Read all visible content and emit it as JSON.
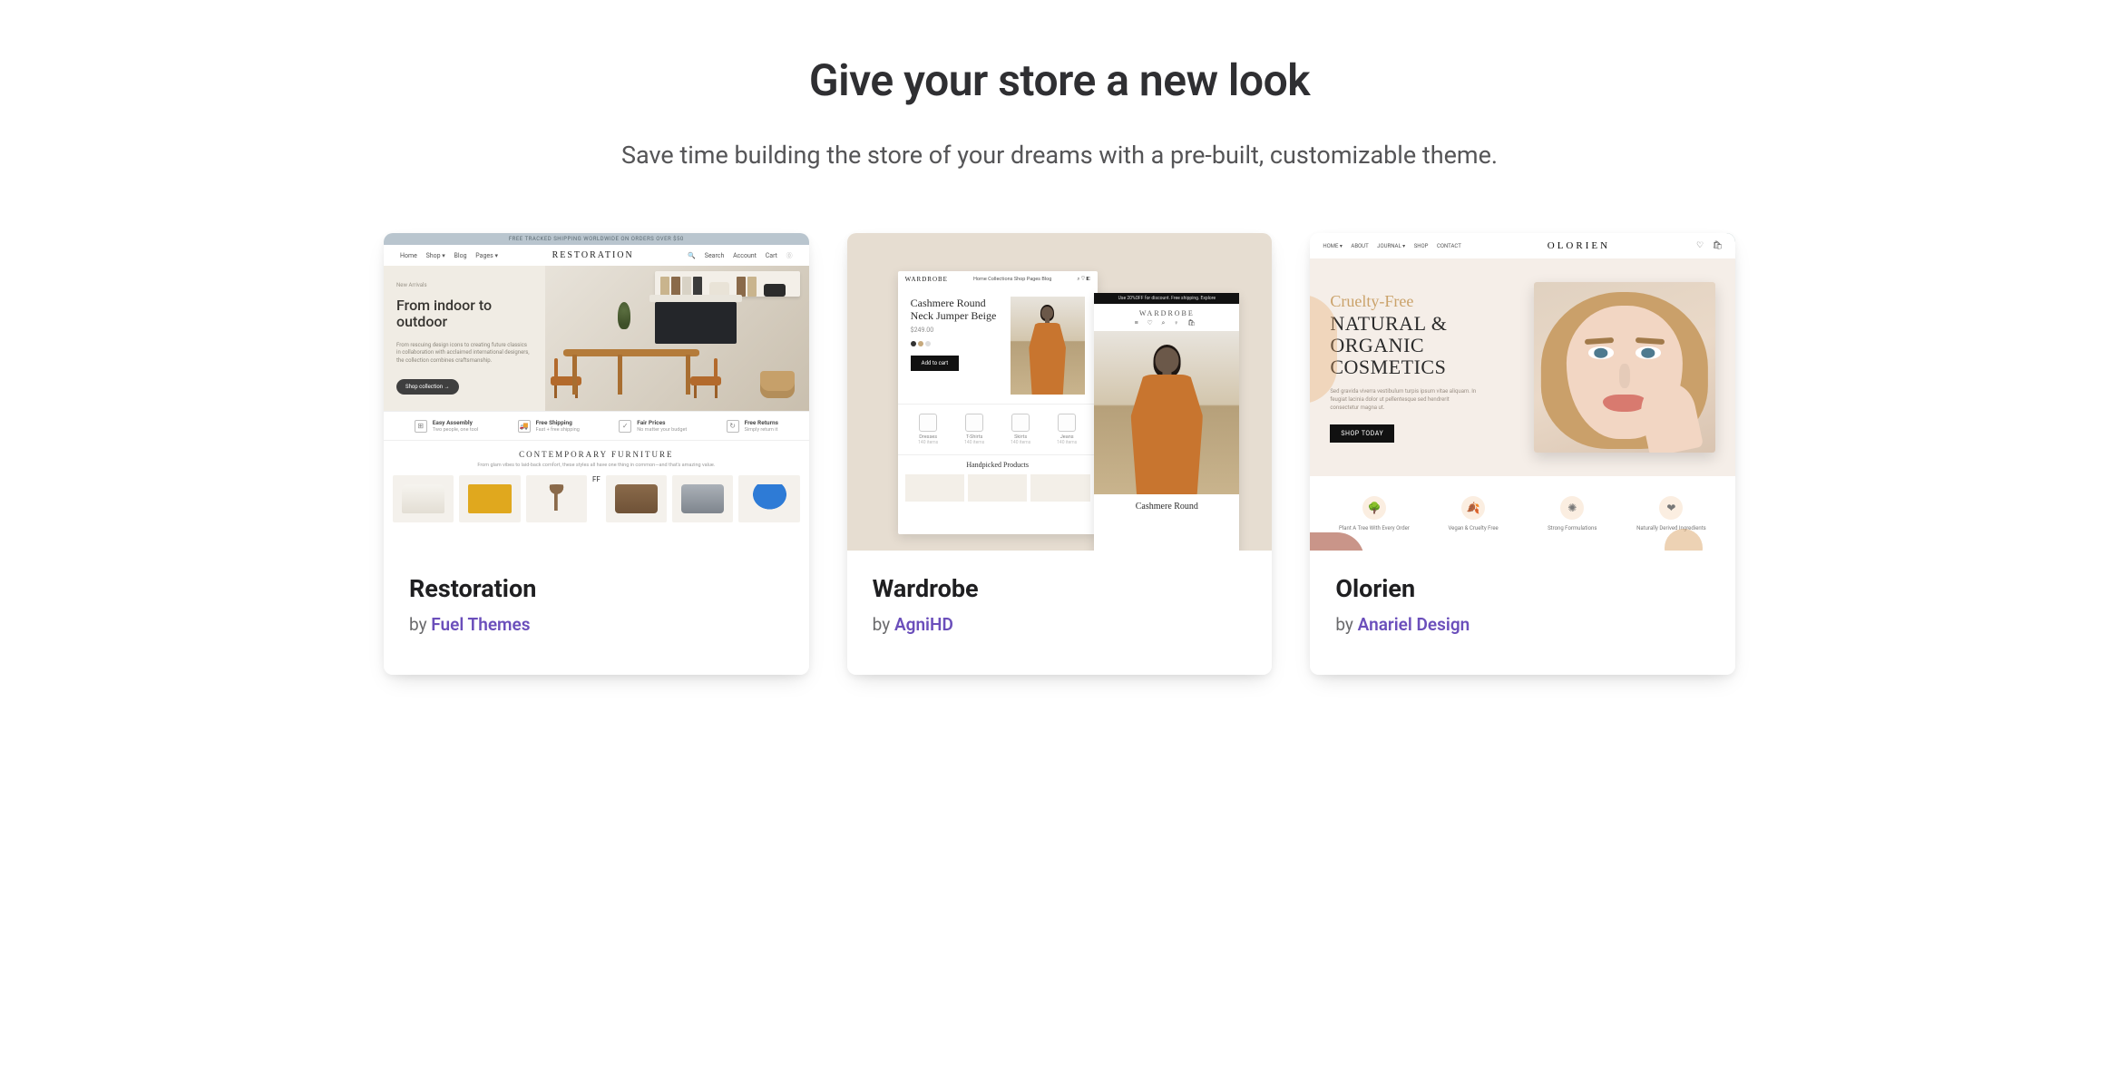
{
  "heading": "Give your store a new look",
  "subheading": "Save time building the store of your dreams with a pre-built, customizable theme.",
  "by_prefix": "by ",
  "themes": [
    {
      "name": "Restoration",
      "author": "Fuel Themes",
      "preview": {
        "topbar": "FREE TRACKED SHIPPING WORLDWIDE ON ORDERS OVER $50",
        "brand": "RESTORATION",
        "nav_left": [
          "Home",
          "Shop ▾",
          "Blog",
          "Pages ▾"
        ],
        "nav_right": [
          "🔍",
          "Search",
          "Account",
          "Cart",
          "⓪"
        ],
        "hero": {
          "eyebrow": "New Arrivals",
          "headline": "From indoor to outdoor",
          "desc": "From rescuing design icons to creating future classics in collaboration with acclaimed international designers, the collection combines craftsmanship.",
          "cta": "Shop collection  →"
        },
        "features": [
          {
            "icon": "⊞",
            "title": "Easy Assembly",
            "sub": "Two people, one tool"
          },
          {
            "icon": "🚚",
            "title": "Free Shipping",
            "sub": "Fast + free shipping"
          },
          {
            "icon": "✓",
            "title": "Fair Prices",
            "sub": "No matter your budget"
          },
          {
            "icon": "↻",
            "title": "Free Returns",
            "sub": "Simply return it"
          }
        ],
        "section_title": "CONTEMPORARY FURNITURE",
        "section_sub": "From glam vibes to laid-back comfort, these styles all have one thing in common—and that's amazing value.",
        "thumbs": [
          "#e9e6df",
          "#e0a81e",
          "#8a6a4a",
          "#8a6a4a",
          "#9aa0a6",
          "#2e7bd6"
        ]
      }
    },
    {
      "name": "Wardrobe",
      "author": "AgniHD",
      "preview": {
        "brand": "WARDROBE",
        "nav_left": [
          "Home",
          "Collections",
          "Shop",
          "Pages",
          "Blog"
        ],
        "nav_right": [
          "⌕",
          "♡",
          "◧"
        ],
        "product_title": "Cashmere Round Neck Jumper Beige",
        "product_price": "$249.00",
        "product_btn": "Add to cart",
        "categories": [
          {
            "label": "Dresses",
            "sub": "140 items"
          },
          {
            "label": "T-Shirts",
            "sub": "140 items"
          },
          {
            "label": "Skirts",
            "sub": "140 items"
          },
          {
            "label": "Jeans",
            "sub": "140 items"
          }
        ],
        "handpicked": "Handpicked Products",
        "right": {
          "topstrip": "Use 20%OFF for discount. Free shipping. Explore",
          "brand": "WARDROBE",
          "icons": "≡ ♡ ⌕ ♀ 🛍",
          "title": "Cashmere Round"
        }
      }
    },
    {
      "name": "Olorien",
      "author": "Anariel Design",
      "preview": {
        "brand": "OLORIEN",
        "nav_left": [
          "HOME ▾",
          "ABOUT",
          "JOURNAL ▾",
          "SHOP",
          "CONTACT"
        ],
        "nav_right": [
          "♡",
          "🛍"
        ],
        "hero": {
          "script": "Cruelty-Free",
          "title_line1": "NATURAL &",
          "title_line2": "ORGANIC",
          "title_line3": "COSMETICS",
          "desc": "Sed gravida viverra vestibulum turpis ipsum vitae aliquam. In feugiat lacinia dolor ut pellentesque sed hendrerit consectetur magna ut.",
          "btn": "SHOP TODAY"
        },
        "features": [
          {
            "emoji": "🌳",
            "label": "Plant A Tree With Every Order"
          },
          {
            "emoji": "🍂",
            "label": "Vegan & Cruelty Free"
          },
          {
            "emoji": "✺",
            "label": "Strong Formulations"
          },
          {
            "emoji": "❤",
            "label": "Naturally Derived Ingredients"
          }
        ]
      }
    }
  ]
}
